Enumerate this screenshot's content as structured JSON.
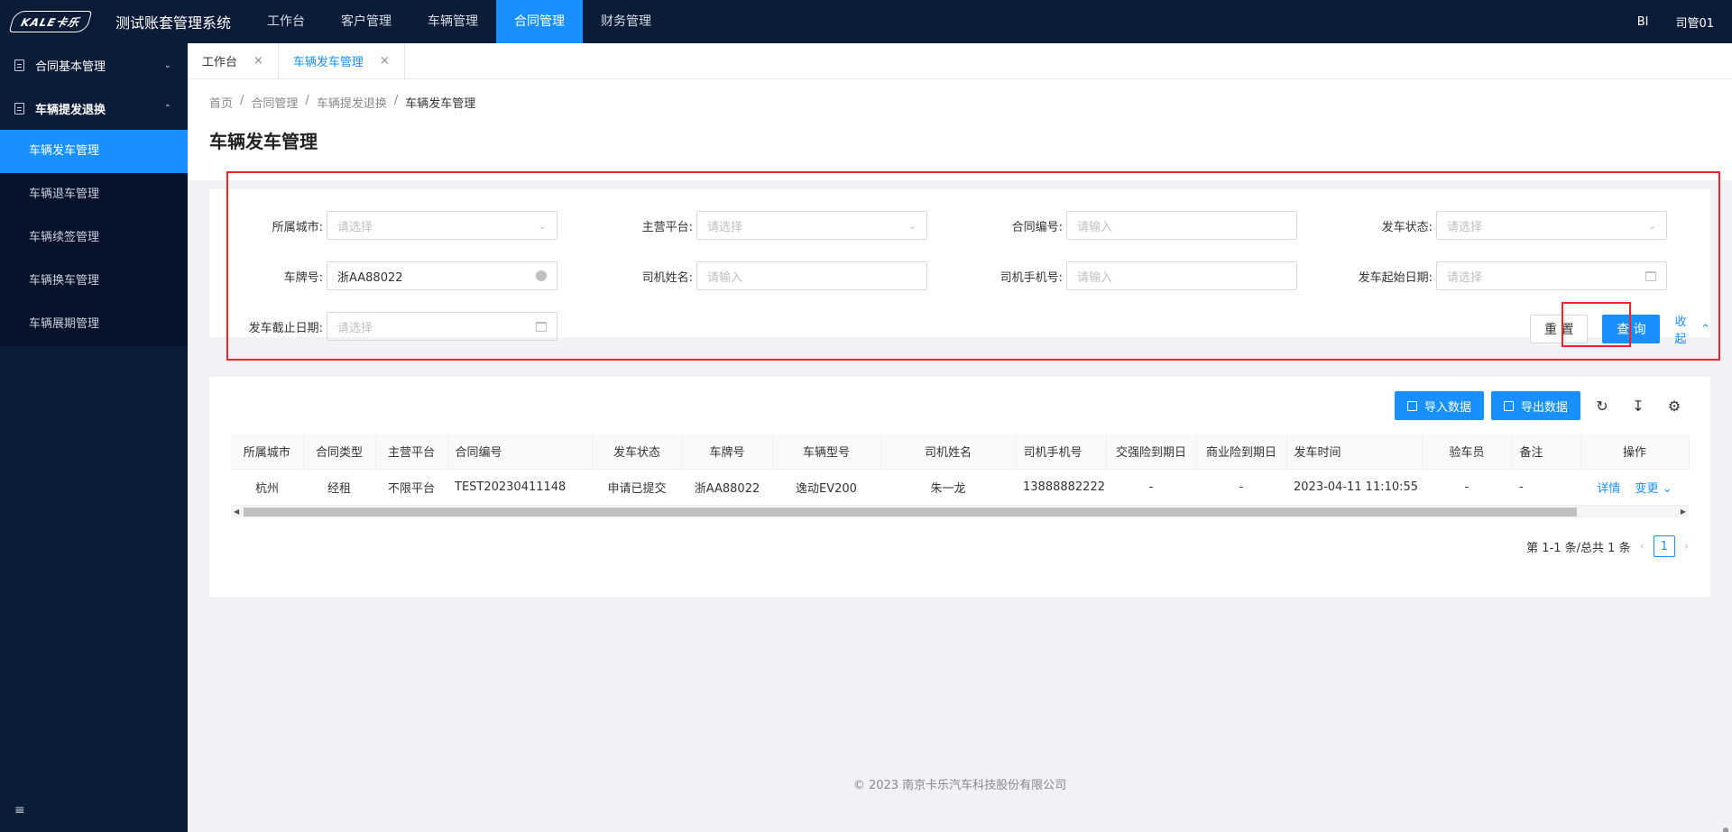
{
  "header": {
    "logo_text": "KALE卡乐",
    "system_title": "测试账套管理系统",
    "nav": [
      "工作台",
      "客户管理",
      "车辆管理",
      "合同管理",
      "财务管理"
    ],
    "active_nav": "合同管理",
    "bi": "BI",
    "user": "司管01"
  },
  "sidebar": {
    "groups": [
      {
        "label": "合同基本管理",
        "expanded": false
      },
      {
        "label": "车辆提发退换",
        "expanded": true
      }
    ],
    "items": [
      "车辆发车管理",
      "车辆退车管理",
      "车辆续签管理",
      "车辆换车管理",
      "车辆展期管理"
    ],
    "active_item": "车辆发车管理"
  },
  "tabs": [
    {
      "label": "工作台",
      "active": false
    },
    {
      "label": "车辆发车管理",
      "active": true
    }
  ],
  "breadcrumb": [
    "首页",
    "合同管理",
    "车辆提发退换",
    "车辆发车管理"
  ],
  "page_title": "车辆发车管理",
  "filters": {
    "city": {
      "label": "所属城市:",
      "placeholder": "请选择"
    },
    "platform": {
      "label": "主营平台:",
      "placeholder": "请选择"
    },
    "contract_no": {
      "label": "合同编号:",
      "placeholder": "请输入"
    },
    "status": {
      "label": "发车状态:",
      "placeholder": "请选择"
    },
    "plate": {
      "label": "车牌号:",
      "value": "浙AA88022"
    },
    "driver_name": {
      "label": "司机姓名:",
      "placeholder": "请输入"
    },
    "driver_phone": {
      "label": "司机手机号:",
      "placeholder": "请输入"
    },
    "start_date": {
      "label": "发车起始日期:",
      "placeholder": "请选择"
    },
    "end_date": {
      "label": "发车截止日期:",
      "placeholder": "请选择"
    },
    "reset_label": "重 置",
    "query_label": "查 询",
    "collapse_label": "收起"
  },
  "toolbar": {
    "import_label": "导入数据",
    "export_label": "导出数据"
  },
  "table": {
    "columns": [
      "所属城市",
      "合同类型",
      "主营平台",
      "合同编号",
      "发车状态",
      "车牌号",
      "车辆型号",
      "司机姓名",
      "司机手机号",
      "交强险到期日",
      "商业险到期日",
      "发车时间",
      "验车员",
      "备注",
      "操作"
    ],
    "rows": [
      {
        "city": "杭州",
        "contract_type": "经租",
        "platform": "不限平台",
        "contract_no": "TEST20230411148",
        "status": "申请已提交",
        "plate": "浙AA88022",
        "model": "逸动EV200",
        "driver": "朱一龙",
        "phone": "13888882222",
        "ci_expire": "-",
        "bi_expire": "-",
        "time": "2023-04-11 11:10:55",
        "inspector": "-",
        "remark": "-",
        "op_detail": "详情",
        "op_change": "变更"
      }
    ]
  },
  "pager": {
    "summary": "第 1-1 条/总共 1 条",
    "current": "1"
  },
  "footer": "© 2023 南京卡乐汽车科技股份有限公司"
}
